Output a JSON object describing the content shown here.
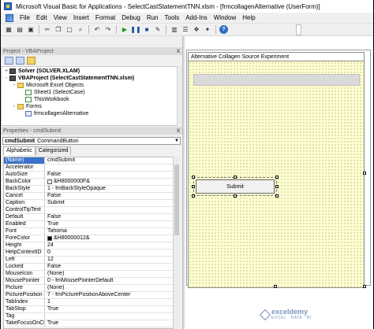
{
  "window": {
    "title": "Microsoft Visual Basic for Applications - SelectCastStatementTNN.xlsm - [frmcollagenAlternative (UserForm)]"
  },
  "menu": {
    "items": [
      "File",
      "Edit",
      "View",
      "Insert",
      "Format",
      "Debug",
      "Run",
      "Tools",
      "Add-Ins",
      "Window",
      "Help"
    ]
  },
  "toolbar": {
    "buttons": [
      "excel-view-icon",
      "insert-userform-icon",
      "save-icon",
      "cut-icon",
      "copy-icon",
      "paste-icon",
      "find-icon",
      "undo-icon",
      "redo-icon",
      "run-icon",
      "break-icon",
      "reset-icon",
      "design-mode-icon",
      "project-explorer-icon",
      "properties-icon",
      "object-browser-icon",
      "toolbox-icon",
      "help-icon"
    ]
  },
  "project_pane": {
    "title": "Project - VBAProject",
    "close_glyph": "x",
    "tree": [
      {
        "label": "Solver (SOLVER.XLAM)",
        "level": 0,
        "expander": "+",
        "icon": "project-icon",
        "bold": true
      },
      {
        "label": "VBAProject (SelectCastStatementTNN.xlsm)",
        "level": 0,
        "expander": "-",
        "icon": "project-icon",
        "bold": true
      },
      {
        "label": "Microsoft Excel Objects",
        "level": 1,
        "expander": "-",
        "icon": "folder-icon",
        "bold": false
      },
      {
        "label": "Sheet1 (SelectCase)",
        "level": 2,
        "expander": "",
        "icon": "sheet-icon",
        "bold": false
      },
      {
        "label": "ThisWorkbook",
        "level": 2,
        "expander": "",
        "icon": "sheet-icon",
        "bold": false
      },
      {
        "label": "Forms",
        "level": 1,
        "expander": "-",
        "icon": "folder-icon",
        "bold": false
      },
      {
        "label": "frmcollagenAlternative",
        "level": 2,
        "expander": "",
        "icon": "form-icon",
        "bold": false
      }
    ]
  },
  "properties_pane": {
    "title": "Properties - cmdSubmit",
    "close_glyph": "x",
    "object_name": "cmdSubmit",
    "object_type": "CommandButton",
    "tabs": [
      "Alphabetic",
      "Categorized"
    ],
    "active_tab": "Alphabetic",
    "rows": [
      {
        "name": "(Name)",
        "value": "cmdSubmit",
        "selected": true
      },
      {
        "name": "Accelerator",
        "value": ""
      },
      {
        "name": "AutoSize",
        "value": "False"
      },
      {
        "name": "BackColor",
        "value": "&H8000000F&",
        "swatch": "#f0f0f0"
      },
      {
        "name": "BackStyle",
        "value": "1 - fmBackStyleOpaque"
      },
      {
        "name": "Cancel",
        "value": "False"
      },
      {
        "name": "Caption",
        "value": "Submit"
      },
      {
        "name": "ControlTipText",
        "value": ""
      },
      {
        "name": "Default",
        "value": "False"
      },
      {
        "name": "Enabled",
        "value": "True"
      },
      {
        "name": "Font",
        "value": "Tahoma"
      },
      {
        "name": "ForeColor",
        "value": "&H80000012&",
        "swatch": "#000000"
      },
      {
        "name": "Height",
        "value": "24"
      },
      {
        "name": "HelpContextID",
        "value": "0"
      },
      {
        "name": "Left",
        "value": "12"
      },
      {
        "name": "Locked",
        "value": "False"
      },
      {
        "name": "MouseIcon",
        "value": "(None)"
      },
      {
        "name": "MousePointer",
        "value": "0 - fmMousePointerDefault"
      },
      {
        "name": "Picture",
        "value": "(None)"
      },
      {
        "name": "PicturePosition",
        "value": "7 - fmPicturePositionAboveCenter"
      },
      {
        "name": "TabIndex",
        "value": "1"
      },
      {
        "name": "TabStop",
        "value": "True"
      },
      {
        "name": "Tag",
        "value": ""
      },
      {
        "name": "TakeFocusOnClick",
        "value": "True"
      }
    ]
  },
  "userform": {
    "caption": "Alternative Collagen Source Experiment",
    "button_caption": "Submit",
    "background_color": "#ffffcf"
  },
  "watermark": {
    "brand": "exceldemy",
    "tagline": "EXCEL · DATA · BI"
  }
}
